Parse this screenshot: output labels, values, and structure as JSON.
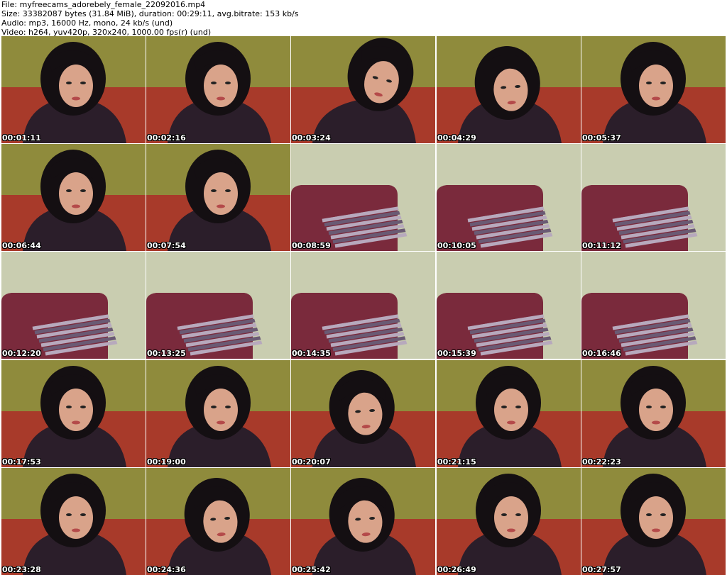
{
  "header": {
    "file_line": "File: myfreecams_adorebely_female_22092016.mp4",
    "size_line": "Size: 33382087 bytes (31.84 MiB), duration: 00:29:11, avg.bitrate: 153 kb/s",
    "audio_line": "Audio: mp3, 16000 Hz, mono, 24 kb/s (und)",
    "video_line": "Video: h264, yuv420p, 320x240, 1000.00 fps(r) (und)"
  },
  "thumbnails": [
    {
      "time": "00:01:11",
      "scene": "person"
    },
    {
      "time": "00:02:16",
      "scene": "person"
    },
    {
      "time": "00:03:24",
      "scene": "person-lean"
    },
    {
      "time": "00:04:29",
      "scene": "person-down"
    },
    {
      "time": "00:05:37",
      "scene": "person"
    },
    {
      "time": "00:06:44",
      "scene": "person"
    },
    {
      "time": "00:07:54",
      "scene": "person"
    },
    {
      "time": "00:08:59",
      "scene": "pillow"
    },
    {
      "time": "00:10:05",
      "scene": "pillow"
    },
    {
      "time": "00:11:12",
      "scene": "pillow"
    },
    {
      "time": "00:12:20",
      "scene": "pillow"
    },
    {
      "time": "00:13:25",
      "scene": "pillow"
    },
    {
      "time": "00:14:35",
      "scene": "pillow"
    },
    {
      "time": "00:15:39",
      "scene": "pillow"
    },
    {
      "time": "00:16:46",
      "scene": "pillow"
    },
    {
      "time": "00:17:53",
      "scene": "person"
    },
    {
      "time": "00:19:00",
      "scene": "person"
    },
    {
      "time": "00:20:07",
      "scene": "person-down"
    },
    {
      "time": "00:21:15",
      "scene": "person"
    },
    {
      "time": "00:22:23",
      "scene": "person"
    },
    {
      "time": "00:23:28",
      "scene": "person"
    },
    {
      "time": "00:24:36",
      "scene": "person-down"
    },
    {
      "time": "00:25:42",
      "scene": "person-down"
    },
    {
      "time": "00:26:49",
      "scene": "person"
    },
    {
      "time": "00:27:57",
      "scene": "person"
    }
  ],
  "colors": {
    "wall_person": "#8f8b3c",
    "wall_pillow": "#c9cdb0",
    "sofa": "#a83a2a",
    "sofa_pillow_scene": "#7a2a3c",
    "shirt": "#2b1e2a",
    "hair": "#140f12",
    "skin": "#d9a38a",
    "pillow_stripe_a": "#6a5a74",
    "pillow_stripe_b": "#b7a9bd"
  }
}
